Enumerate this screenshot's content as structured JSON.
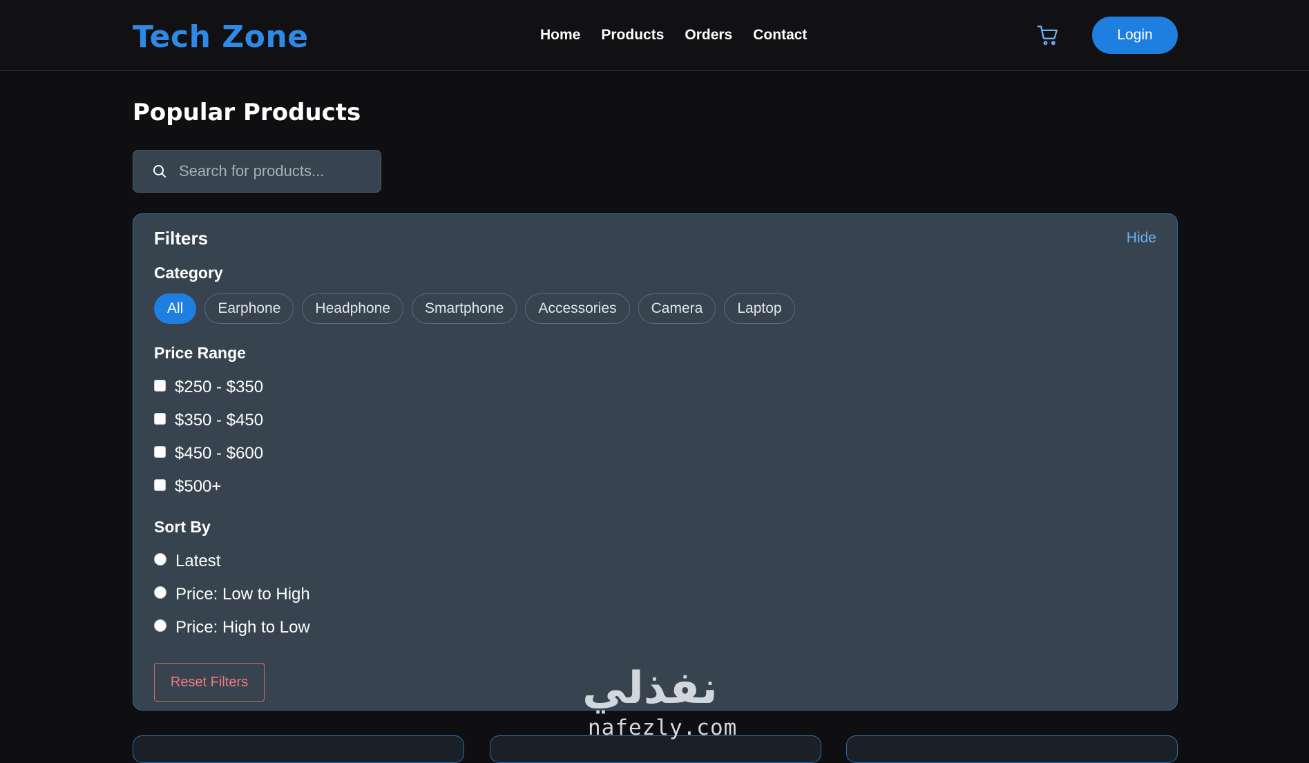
{
  "header": {
    "logo": "Tech Zone",
    "nav": [
      "Home",
      "Products",
      "Orders",
      "Contact"
    ],
    "cart_icon": "cart-icon",
    "login_label": "Login"
  },
  "main": {
    "title": "Popular Products",
    "search": {
      "placeholder": "Search for products...",
      "value": "",
      "icon": "search-icon"
    }
  },
  "filters": {
    "title": "Filters",
    "hide_label": "Hide",
    "category": {
      "label": "Category",
      "chips": [
        "All",
        "Earphone",
        "Headphone",
        "Smartphone",
        "Accessories",
        "Camera",
        "Laptop"
      ],
      "selected": "All"
    },
    "price": {
      "label": "Price Range",
      "options": [
        "$250 - $350",
        "$350 - $450",
        "$450 - $600",
        "$500+"
      ]
    },
    "sort": {
      "label": "Sort By",
      "options": [
        "Latest",
        "Price: Low to High",
        "Price: High to Low"
      ]
    },
    "reset_label": "Reset Filters"
  },
  "watermark": {
    "arabic": "نفذلي",
    "latin": "nafezly.com"
  },
  "colors": {
    "accent": "#1e7fe0",
    "logo": "#2e8ae6",
    "panel": "#37444f",
    "background": "#0f0f11",
    "danger": "#f07c7c"
  }
}
